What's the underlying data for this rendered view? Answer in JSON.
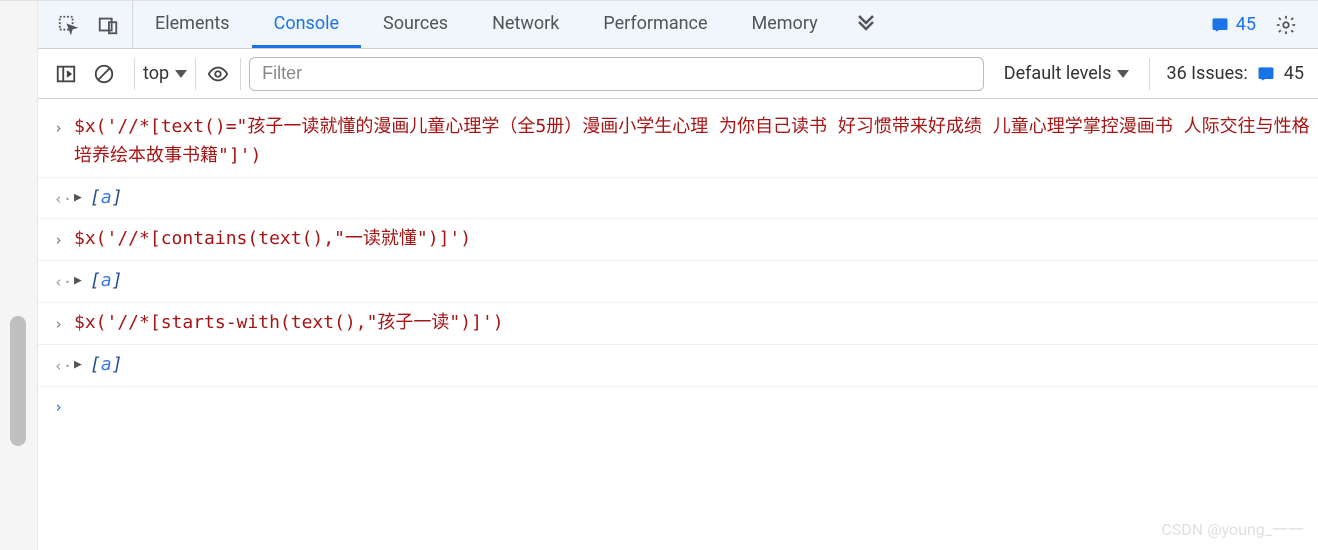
{
  "tabs": {
    "items": [
      "Elements",
      "Console",
      "Sources",
      "Network",
      "Performance",
      "Memory"
    ],
    "active_index": 1
  },
  "header": {
    "message_count": "45"
  },
  "toolbar": {
    "context": "top",
    "filter_placeholder": "Filter",
    "levels_label": "Default levels",
    "issues_label": "36 Issues:",
    "issues_count": "45"
  },
  "console": {
    "entries": [
      {
        "type": "input",
        "code": "$x('//*[text()=\"孩子一读就懂的漫画儿童心理学（全5册）漫画小学生心理 为你自己读书 好习惯带来好成绩 儿童心理学掌控漫画书 人际交往与性格培养绘本故事书籍\"]')"
      },
      {
        "type": "output",
        "result_open": "[",
        "result_link": "a",
        "result_close": "]"
      },
      {
        "type": "input",
        "code": "$x('//*[contains(text(),\"一读就懂\")]')"
      },
      {
        "type": "output",
        "result_open": "[",
        "result_link": "a",
        "result_close": "]"
      },
      {
        "type": "input",
        "code": "$x('//*[starts-with(text(),\"孩子一读\")]')"
      },
      {
        "type": "output",
        "result_open": "[",
        "result_link": "a",
        "result_close": "]"
      }
    ]
  },
  "watermark": "CSDN @young_一一"
}
